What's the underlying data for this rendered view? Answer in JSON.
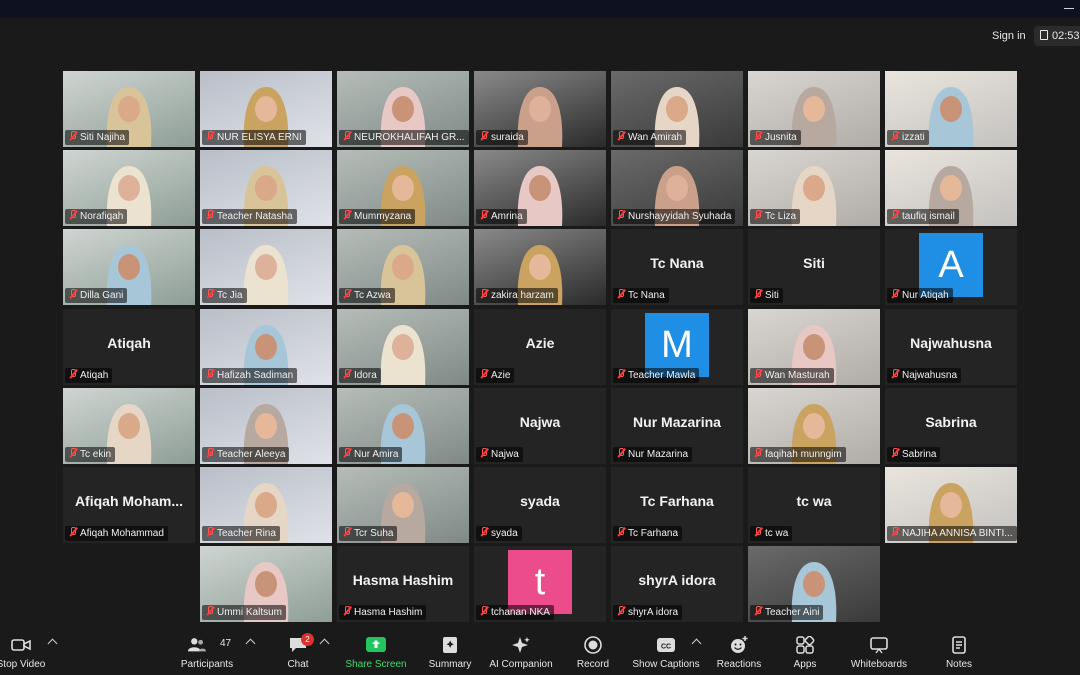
{
  "topbar": {
    "signin_label": "Sign in",
    "timer_text": "02:53"
  },
  "colors": {
    "active_speaker_border": "#d9e36a",
    "share_screen_green": "#22c55e",
    "muted_red": "#ff3b3b",
    "avatar_blue": "#1f8fe6",
    "avatar_pink": "#ec4b8c"
  },
  "participants": [
    {
      "name": "Siti Najiha",
      "video": true
    },
    {
      "name": "NUR ELISYA ERNI",
      "video": true,
      "active": true
    },
    {
      "name": "NEUROKHALIFAH GR...",
      "video": true
    },
    {
      "name": "suraida",
      "video": true
    },
    {
      "name": "Wan Amirah",
      "video": true
    },
    {
      "name": "Jusnita",
      "video": true
    },
    {
      "name": "izzati",
      "video": true
    },
    {
      "name": "Norafiqah",
      "video": true
    },
    {
      "name": "Teacher Natasha",
      "video": true
    },
    {
      "name": "Mummyzana",
      "video": true
    },
    {
      "name": "Amrina",
      "video": true
    },
    {
      "name": "Nurshayyidah Syuhada",
      "video": true
    },
    {
      "name": "Tc Liza",
      "video": true
    },
    {
      "name": "taufiq ismail",
      "video": true
    },
    {
      "name": "Dilla Gani",
      "video": true
    },
    {
      "name": "Tc Jia",
      "video": true
    },
    {
      "name": "Tc Azwa",
      "video": true
    },
    {
      "name": "zakira harzam",
      "video": true
    },
    {
      "name": "Tc Nana",
      "center": "Tc Nana"
    },
    {
      "name": "Siti",
      "center": "Siti"
    },
    {
      "name": "Nur Atiqah",
      "avatar_letter": "A",
      "avatar_color": "blue"
    },
    {
      "name": "Atiqah",
      "center": "Atiqah"
    },
    {
      "name": "Hafizah Sadiman",
      "video": true
    },
    {
      "name": "Idora",
      "video": true
    },
    {
      "name": "Azie",
      "center": "Azie"
    },
    {
      "name": "Teacher Mawla",
      "avatar_letter": "M",
      "avatar_color": "blue"
    },
    {
      "name": "Wan Masturah",
      "video": true
    },
    {
      "name": "Najwahusna",
      "center": "Najwahusna"
    },
    {
      "name": "Tc ekin",
      "video": true
    },
    {
      "name": "Teacher Aleeya",
      "video": true
    },
    {
      "name": "Nur Amira",
      "video": true
    },
    {
      "name": "Najwa",
      "center": "Najwa"
    },
    {
      "name": "Nur Mazarina",
      "center": "Nur Mazarina"
    },
    {
      "name": "faqihah munngim",
      "video": true
    },
    {
      "name": "Sabrina",
      "center": "Sabrina"
    },
    {
      "name": "Afiqah Mohammad",
      "center": "Afiqah  Moham..."
    },
    {
      "name": "Teacher Rina",
      "video": true
    },
    {
      "name": "Tcr Suha",
      "video": true
    },
    {
      "name": "syada",
      "center": "syada"
    },
    {
      "name": "Tc Farhana",
      "center": "Tc Farhana"
    },
    {
      "name": "tc wa",
      "center": "tc wa"
    },
    {
      "name": "NAJIHA ANNISA BINTI...",
      "video": true
    },
    {
      "name": "Ummi Kaltsum",
      "video": true
    },
    {
      "name": "Hasma Hashim",
      "center": "Hasma Hashim"
    },
    {
      "name": "tchanan NKA",
      "avatar_letter": "t",
      "avatar_color": "pink"
    },
    {
      "name": "shyrA idora",
      "center": "shyrA idora"
    },
    {
      "name": "Teacher Aini",
      "video": true
    }
  ],
  "toolbar": {
    "stop_video": "Stop Video",
    "participants": "Participants",
    "participants_count": "47",
    "chat": "Chat",
    "chat_badge": "2",
    "share_screen": "Share Screen",
    "summary": "Summary",
    "ai_companion": "AI Companion",
    "record": "Record",
    "show_captions": "Show Captions",
    "reactions": "Reactions",
    "apps": "Apps",
    "whiteboards": "Whiteboards",
    "notes": "Notes"
  }
}
